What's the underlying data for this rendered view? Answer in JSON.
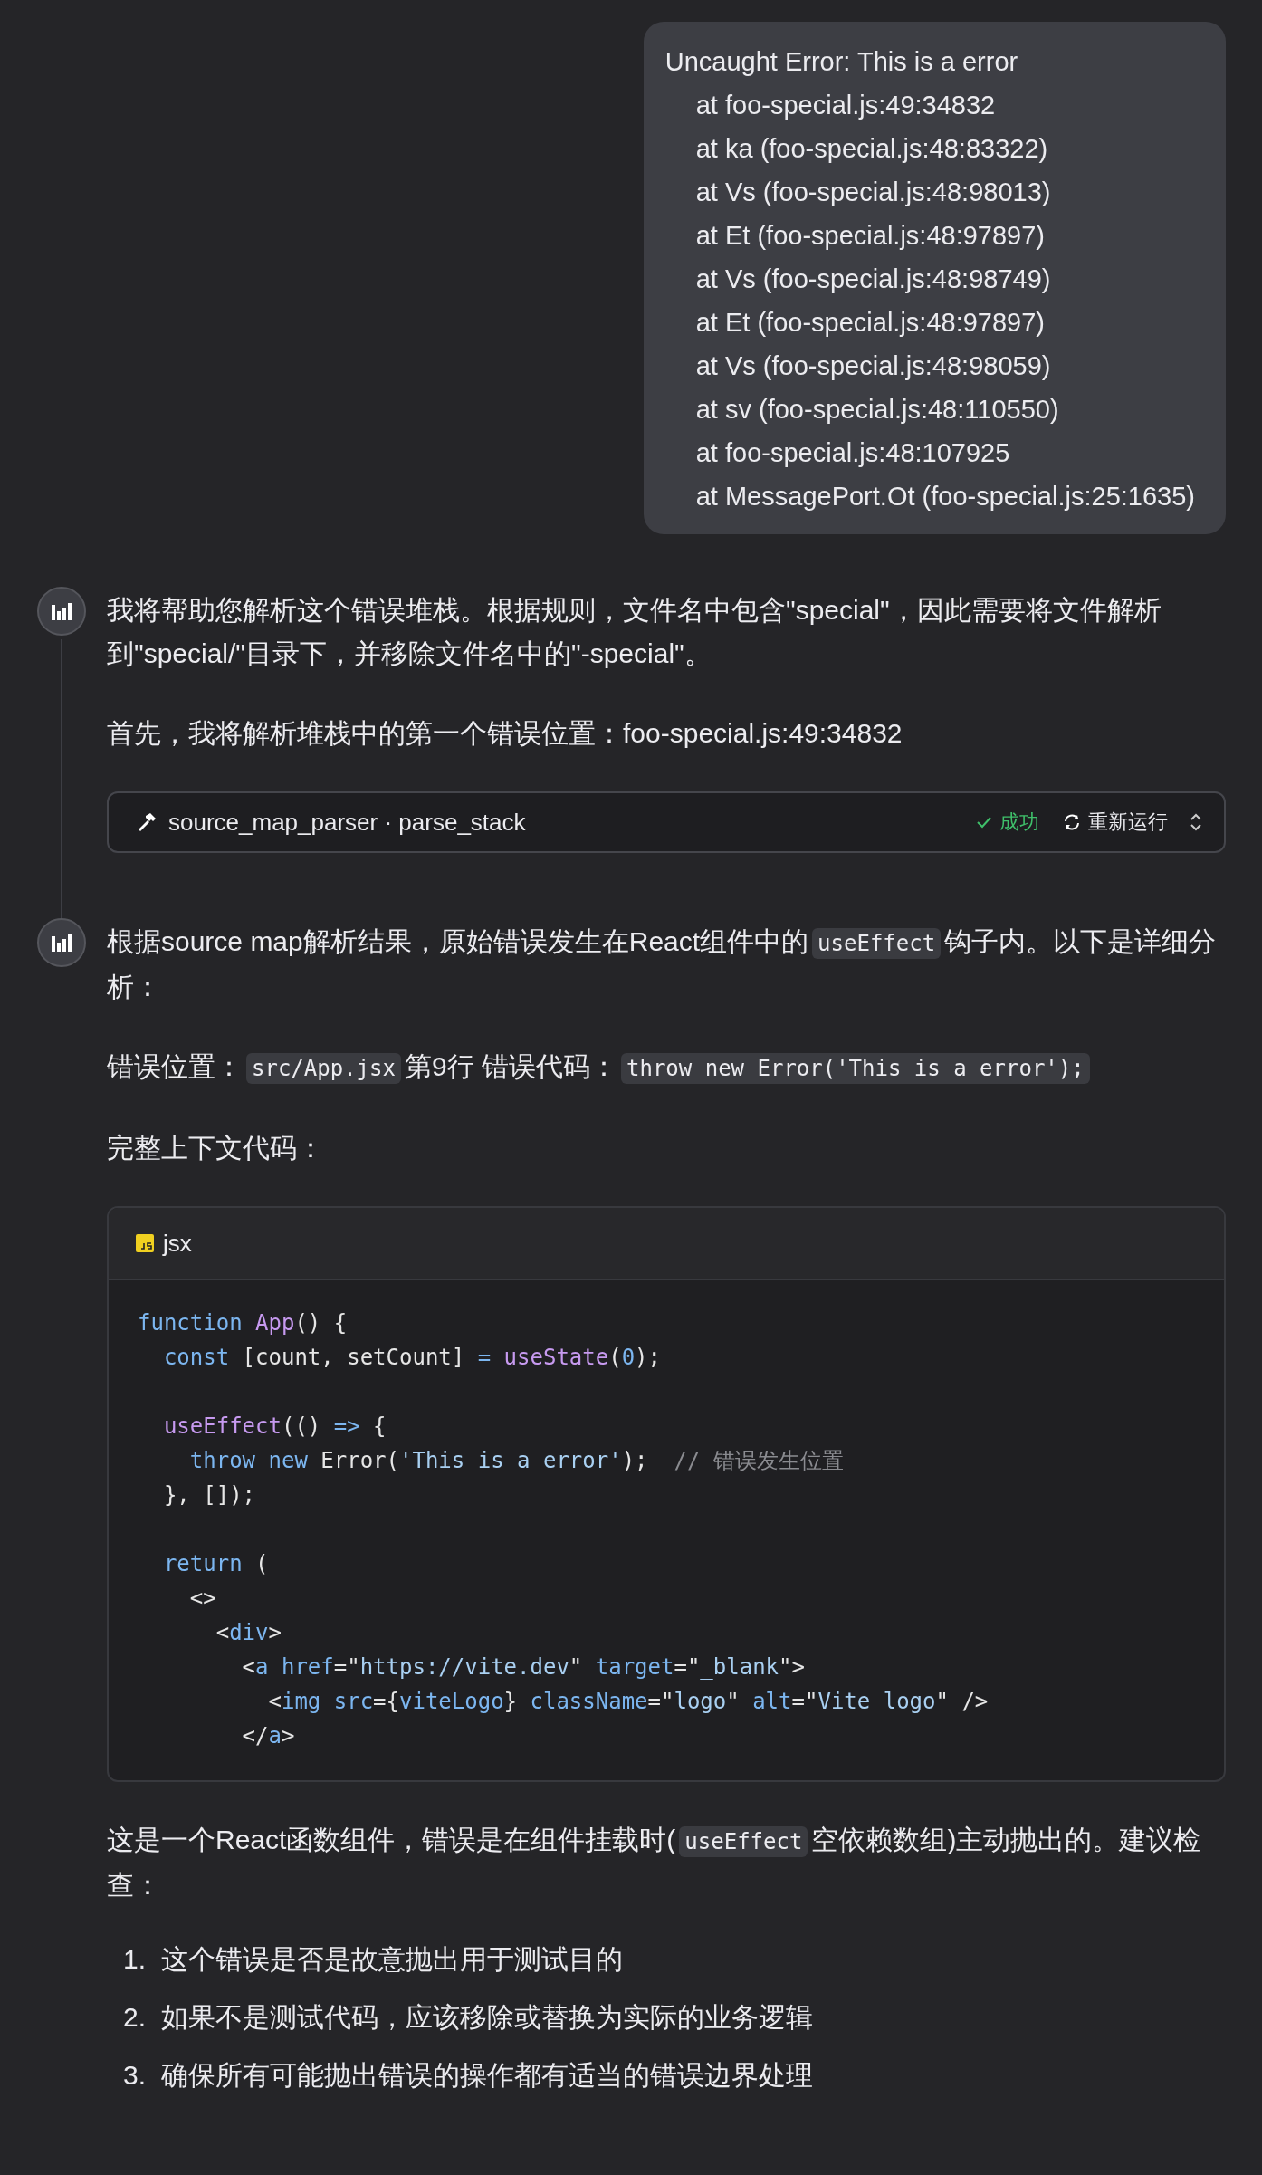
{
  "user_message": {
    "lines": [
      "Uncaught Error: This is a error",
      "at foo-special.js:49:34832",
      "at ka (foo-special.js:48:83322)",
      "at Vs (foo-special.js:48:98013)",
      "at Et (foo-special.js:48:97897)",
      "at Vs (foo-special.js:48:98749)",
      "at Et (foo-special.js:48:97897)",
      "at Vs (foo-special.js:48:98059)",
      "at sv (foo-special.js:48:110550)",
      "at foo-special.js:48:107925",
      "at MessagePort.Ot (foo-special.js:25:1635)"
    ]
  },
  "assistant_turns": [
    {
      "blocks": [
        {
          "kind": "paragraph",
          "segments": [
            {
              "kind": "text",
              "text": "我将帮助您解析这个错误堆栈。根据规则，文件名中包含\"special\"，因此需要将文件解析到\"special/\"目录下，并移除文件名中的\"-special\"。"
            }
          ]
        },
        {
          "kind": "paragraph",
          "segments": [
            {
              "kind": "text",
              "text": "首先，我将解析堆栈中的第一个错误位置：foo-special.js:49:34832"
            }
          ]
        },
        {
          "kind": "tool_call",
          "name": "source_map_parser · parse_stack",
          "status": "成功",
          "succeeded": true,
          "rerun": "重新运行"
        }
      ]
    },
    {
      "blocks": [
        {
          "kind": "paragraph",
          "segments": [
            {
              "kind": "text",
              "text": "根据source map解析结果，原始错误发生在React组件中的"
            },
            {
              "kind": "code",
              "text": "useEffect"
            },
            {
              "kind": "text",
              "text": "钩子内。以下是详细分析："
            }
          ]
        },
        {
          "kind": "paragraph",
          "segments": [
            {
              "kind": "text",
              "text": "错误位置："
            },
            {
              "kind": "code",
              "text": "src/App.jsx"
            },
            {
              "kind": "text",
              "text": "第9行 错误代码："
            },
            {
              "kind": "code",
              "text": "throw new Error('This is a error');"
            }
          ]
        },
        {
          "kind": "paragraph",
          "segments": [
            {
              "kind": "text",
              "text": "完整上下文代码："
            }
          ]
        },
        {
          "kind": "code_block",
          "language": "jsx",
          "lines": [
            {
              "kind": "code",
              "tokens": [
                {
                  "kind": "keyword",
                  "text": "function "
                },
                {
                  "kind": "func",
                  "text": "App"
                },
                {
                  "kind": "plain",
                  "text": "() {"
                }
              ]
            },
            {
              "kind": "code",
              "tokens": [
                {
                  "kind": "keyword",
                  "text": "  const"
                },
                {
                  "kind": "plain",
                  "text": " [count, setCount] "
                },
                {
                  "kind": "keyword",
                  "text": "="
                },
                {
                  "kind": "func",
                  "text": " useState"
                },
                {
                  "kind": "plain",
                  "text": "("
                },
                {
                  "kind": "number",
                  "text": "0"
                },
                {
                  "kind": "plain",
                  "text": ");"
                }
              ]
            },
            {
              "kind": "blank"
            },
            {
              "kind": "code",
              "tokens": [
                {
                  "kind": "func",
                  "text": "  useEffect"
                },
                {
                  "kind": "plain",
                  "text": "(() "
                },
                {
                  "kind": "keyword",
                  "text": "=>"
                },
                {
                  "kind": "plain",
                  "text": " {"
                }
              ]
            },
            {
              "kind": "code",
              "tokens": [
                {
                  "kind": "keyword",
                  "text": "    throw new"
                },
                {
                  "kind": "plain",
                  "text": " Error("
                },
                {
                  "kind": "string",
                  "text": "'This is a error'"
                },
                {
                  "kind": "plain",
                  "text": ");  "
                },
                {
                  "kind": "comment",
                  "text": "// 错误发生位置"
                }
              ]
            },
            {
              "kind": "code",
              "tokens": [
                {
                  "kind": "plain",
                  "text": "  }, []);"
                }
              ]
            },
            {
              "kind": "blank"
            },
            {
              "kind": "code",
              "tokens": [
                {
                  "kind": "keyword",
                  "text": "  return"
                },
                {
                  "kind": "plain",
                  "text": " ("
                }
              ]
            },
            {
              "kind": "code",
              "tokens": [
                {
                  "kind": "plain",
                  "text": "    <>"
                }
              ]
            },
            {
              "kind": "code",
              "tokens": [
                {
                  "kind": "plain",
                  "text": "      <"
                },
                {
                  "kind": "tag",
                  "text": "div"
                },
                {
                  "kind": "plain",
                  "text": ">"
                }
              ]
            },
            {
              "kind": "code",
              "tokens": [
                {
                  "kind": "plain",
                  "text": "        <"
                },
                {
                  "kind": "tag",
                  "text": "a href"
                },
                {
                  "kind": "plain",
                  "text": "=\""
                },
                {
                  "kind": "string",
                  "text": "https://vite.dev"
                },
                {
                  "kind": "plain",
                  "text": "\" "
                },
                {
                  "kind": "tag",
                  "text": "target"
                },
                {
                  "kind": "plain",
                  "text": "=\""
                },
                {
                  "kind": "string",
                  "text": "_blank"
                },
                {
                  "kind": "plain",
                  "text": "\">"
                }
              ]
            },
            {
              "kind": "code",
              "tokens": [
                {
                  "kind": "plain",
                  "text": "          <"
                },
                {
                  "kind": "tag",
                  "text": "img src"
                },
                {
                  "kind": "plain",
                  "text": "={"
                },
                {
                  "kind": "tag",
                  "text": "viteLogo"
                },
                {
                  "kind": "plain",
                  "text": "} "
                },
                {
                  "kind": "tag",
                  "text": "className"
                },
                {
                  "kind": "plain",
                  "text": "=\""
                },
                {
                  "kind": "string",
                  "text": "logo"
                },
                {
                  "kind": "plain",
                  "text": "\" "
                },
                {
                  "kind": "tag",
                  "text": "alt"
                },
                {
                  "kind": "plain",
                  "text": "=\""
                },
                {
                  "kind": "string",
                  "text": "Vite logo"
                },
                {
                  "kind": "plain",
                  "text": "\" />"
                }
              ]
            },
            {
              "kind": "code",
              "tokens": [
                {
                  "kind": "plain",
                  "text": "        </"
                },
                {
                  "kind": "tag",
                  "text": "a"
                },
                {
                  "kind": "plain",
                  "text": ">"
                }
              ]
            }
          ]
        },
        {
          "kind": "paragraph",
          "segments": [
            {
              "kind": "text",
              "text": "这是一个React函数组件，错误是在组件挂载时("
            },
            {
              "kind": "code",
              "text": "useEffect"
            },
            {
              "kind": "text",
              "text": "空依赖数组)主动抛出的。建议检查："
            }
          ]
        },
        {
          "kind": "ordered_list",
          "items": [
            {
              "number": "1.",
              "text": "这个错误是否是故意抛出用于测试目的"
            },
            {
              "number": "2.",
              "text": "如果不是测试代码，应该移除或替换为实际的业务逻辑"
            },
            {
              "number": "3.",
              "text": "确保所有可能抛出错误的操作都有适当的错误边界处理"
            }
          ]
        }
      ]
    }
  ]
}
